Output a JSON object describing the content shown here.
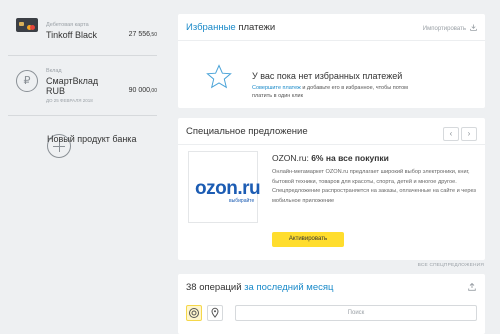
{
  "accounts": [
    {
      "type": "Дебетовая карта",
      "name": "Tinkoff Black",
      "amount": "27 556",
      "cents": ",50"
    },
    {
      "type": "Вклад",
      "name": "СмартВклад",
      "currency": "RUB",
      "amount": "90 000",
      "cents": ",00",
      "until": "до 25 февраля 2018"
    }
  ],
  "new_product_label": "Новый продукт банка",
  "favorites": {
    "title_link": "Избранные",
    "title_rest": " платежи",
    "import_label": "Импортировать",
    "empty_title": "У вас пока нет избранных платежей",
    "empty_link": "Совершите платеж",
    "empty_text": " и добавьте его в избранное, чтобы потом платить в один клик"
  },
  "offer": {
    "section_title": "Специальное предложение",
    "partner": "OZON.ru: ",
    "deal": "6% на все покупки",
    "logo_text": "ozon.ru",
    "logo_tag": "выбирайте",
    "description": "Онлайн-мегамаркет OZON.ru предлагает широкий выбор электроники, книг, бытовой техники, товаров для красоты, спорта, детей и многое другое. Спецпредложение распространяется на заказы, оплаченные на сайте и через мобильное приложение",
    "button": "Активировать",
    "all_link": "ВСЕ СПЕЦПРЕДЛОЖЕНИЯ",
    "prev": "‹",
    "next": "›"
  },
  "operations": {
    "count_text": "38 операций ",
    "period_link": "за последний месяц",
    "search_placeholder": "Поиск"
  },
  "colors": {
    "accent": "#1a8ac9",
    "button": "#ffdd2d",
    "background": "#eef0f2"
  }
}
